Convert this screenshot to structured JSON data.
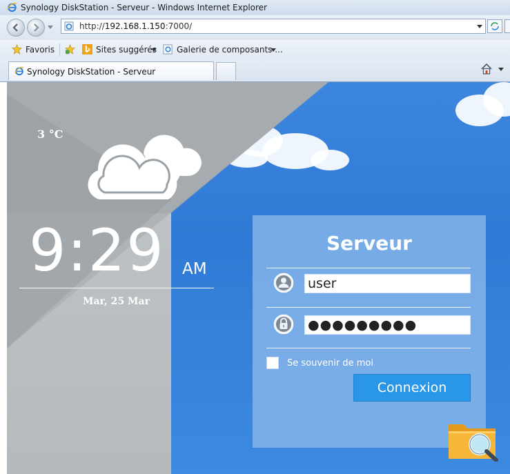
{
  "window": {
    "title": "Synology DiskStation - Serveur - Windows Internet Explorer"
  },
  "address_bar": {
    "url_prefix": "http://",
    "url_host": "192.168.1.150",
    "url_suffix": ":7000/"
  },
  "favorites_bar": {
    "favorites_label": "Favoris",
    "suggested_sites_label": "Sites suggérés",
    "gallery_label": "Galerie de composants ..."
  },
  "tabs": [
    {
      "label": "Synology DiskStation - Serveur"
    }
  ],
  "weather": {
    "temperature": "3 °C",
    "icon": "cloud-icon"
  },
  "clock": {
    "time": "9:29",
    "ampm": "AM",
    "date": "Mar, 25 Mar"
  },
  "login": {
    "title": "Serveur",
    "username_value": "user",
    "password_value": "●●●●●●●●●",
    "remember_label": "Se souvenir de moi",
    "remember_checked": false,
    "submit_label": "Connexion"
  },
  "colors": {
    "sky_blue": "#3c86de",
    "login_button": "#2a96e8",
    "concrete": "#bcc1c4"
  }
}
